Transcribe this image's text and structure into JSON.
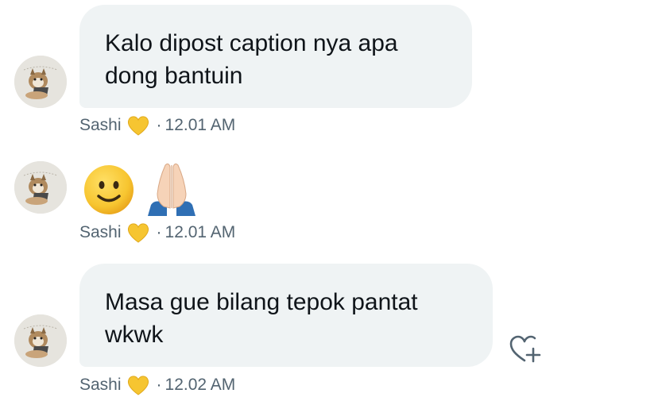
{
  "messages": [
    {
      "text": "Kalo dipost caption nya apa\ndong bantuin",
      "sender": "Sashi",
      "time": "12.01 AM"
    },
    {
      "emojis": [
        "slightly-smiling-face",
        "folded-hands"
      ],
      "sender": "Sashi",
      "time": "12.01 AM"
    },
    {
      "text": "Masa gue bilang tepok pantat\nwkwk",
      "sender": "Sashi",
      "time": "12.02 AM"
    }
  ],
  "separator": "·",
  "colors": {
    "bubble_bg": "#eff3f4",
    "text": "#0f1419",
    "meta": "#536471",
    "heart_emoji": "#f6c531"
  }
}
